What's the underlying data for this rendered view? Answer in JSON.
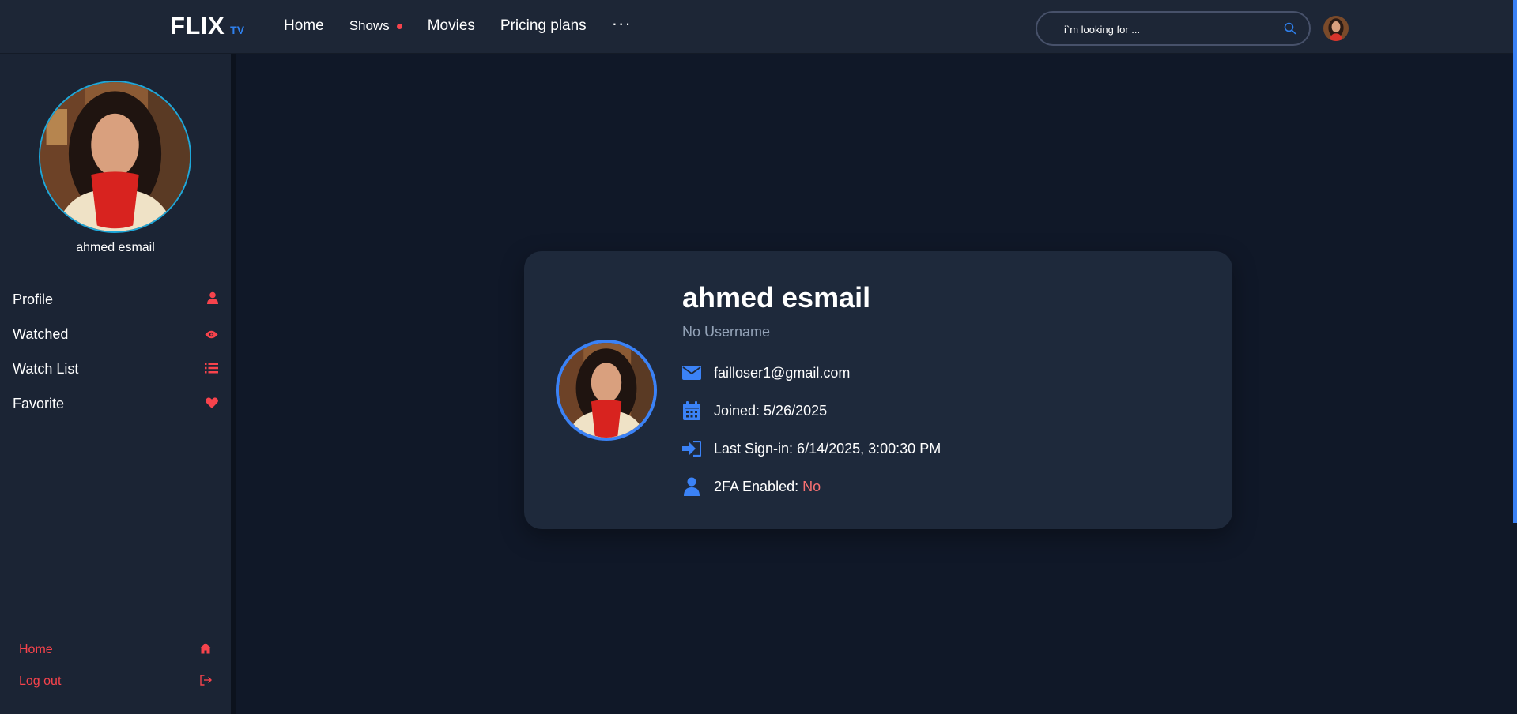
{
  "header": {
    "logo": "FLIX",
    "logo_sub": "TV",
    "nav": [
      {
        "label": "Home"
      },
      {
        "label": "Shows"
      },
      {
        "label": "Movies"
      },
      {
        "label": "Pricing plans"
      }
    ],
    "more_label": "···",
    "search_placeholder": "i`m looking for ...",
    "accent_color": "#2f80ed",
    "dot_color": "#f7434c"
  },
  "sidebar": {
    "user_name": "ahmed esmail",
    "menu": [
      {
        "label": "Profile",
        "icon": "user-icon"
      },
      {
        "label": "Watched",
        "icon": "eye-icon"
      },
      {
        "label": "Watch List",
        "icon": "list-icon"
      },
      {
        "label": "Favorite",
        "icon": "heart-icon"
      }
    ],
    "bottom": [
      {
        "label": "Home",
        "icon": "home-icon"
      },
      {
        "label": "Log out",
        "icon": "logout-icon"
      }
    ],
    "icon_color": "#f7434c"
  },
  "profile": {
    "name": "ahmed esmail",
    "username": "No Username",
    "email": "failloser1@gmail.com",
    "joined": "Joined: 5/26/2025",
    "last_signin": "Last Sign-in: 6/14/2025, 3:00:30 PM",
    "twofa_label": "2FA Enabled:",
    "twofa_value": "No",
    "icon_color": "#3b82f6"
  }
}
